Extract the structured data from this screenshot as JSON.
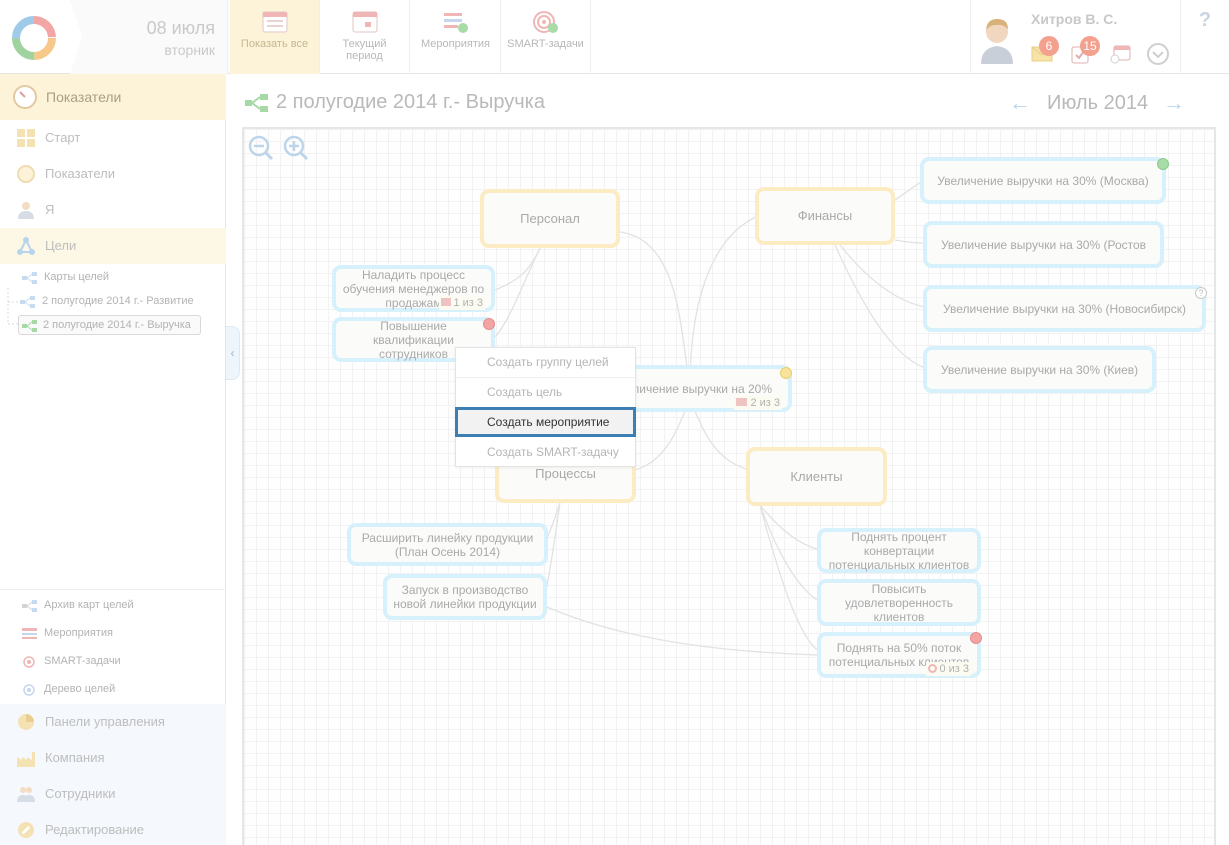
{
  "header": {
    "date_day": "08 июля",
    "date_weekday": "вторник",
    "buttons": [
      {
        "label": "Показать все"
      },
      {
        "label": "Текущий период"
      },
      {
        "label": "Мероприятия"
      },
      {
        "label": "SMART-задачи"
      }
    ],
    "user_name": "Хитров В. С.",
    "badge_mail": "6",
    "badge_tasks": "15",
    "help": "?"
  },
  "sidebar": {
    "header": "Показатели",
    "items": [
      {
        "label": "Старт"
      },
      {
        "label": "Показатели"
      },
      {
        "label": "Я"
      },
      {
        "label": "Цели"
      }
    ],
    "goal_maps": "Карты целей",
    "maps": [
      "2 полугодие 2014 г.- Развитие",
      "2 полугодие 2014 г.- Выручка"
    ],
    "bottom": [
      "Архив карт целей",
      "Мероприятия",
      "SMART-задачи",
      "Дерево целей"
    ],
    "sections": [
      "Панели управления",
      "Компания",
      "Сотрудники",
      "Редактирование"
    ]
  },
  "main": {
    "title": "2 полугодие 2014 г.- Выручка",
    "month": "Июль 2014",
    "arrow_prev": "←",
    "arrow_next": "→"
  },
  "map": {
    "categories": {
      "personnel": "Персонал",
      "finance": "Финансы",
      "processes": "Процессы",
      "clients": "Клиенты"
    },
    "center": {
      "label": "Увеличение выручки на 20%",
      "meta": "2 из 3"
    },
    "goals": {
      "g_sales": {
        "label": "Наладить процесс обучения менеджеров по продажам",
        "meta": "1 из 3"
      },
      "g_qual": {
        "label": "Повышение квалификации сотрудников"
      },
      "g_msk": {
        "label": "Увеличение выручки на 30% (Москва)"
      },
      "g_rst": {
        "label": "Увеличение выручки на 30% (Ростов"
      },
      "g_nsk": {
        "label": "Увеличение выручки на 30% (Новосибирск)"
      },
      "g_kiev": {
        "label": "Увеличение выручки на 30% (Киев)"
      },
      "g_line": {
        "label": "Расширить линейку продукции (План Осень 2014)"
      },
      "g_prod": {
        "label": "Запуск в производство новой линейки продукции"
      },
      "g_conv": {
        "label": "Поднять процент конвертации потенциальных клиентов"
      },
      "g_sat": {
        "label": "Повысить удовлетворенность клиентов"
      },
      "g_flow": {
        "label": "Поднять на 50% поток потенциальных клиентов",
        "meta": "0 из 3"
      }
    },
    "status_question": "?"
  },
  "context_menu": {
    "items": [
      "Создать группу целей",
      "Создать цель",
      "Создать мероприятие",
      "Создать SMART-задачу"
    ]
  },
  "colors": {
    "accent_blue": "#3d7fb3",
    "category_border": "#fbecc4",
    "goal_border": "#d6f1fb",
    "highlight": "#fdf3d9"
  }
}
